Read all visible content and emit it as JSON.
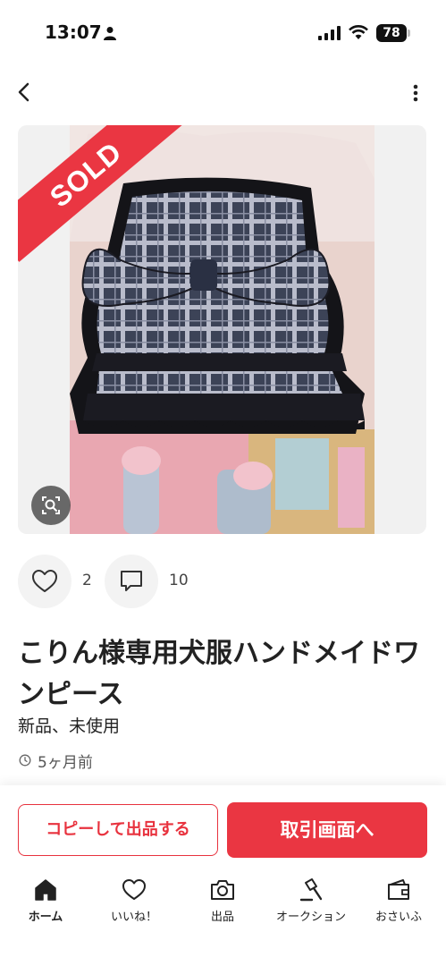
{
  "status": {
    "time": "13:07",
    "battery": "78"
  },
  "product": {
    "sold_badge": "SOLD",
    "likes": "2",
    "comments": "10",
    "title": "こりん様専用犬服ハンドメイドワンピース",
    "condition": "新品、未使用",
    "posted": "5ヶ月前"
  },
  "actions": {
    "copy_label": "コピーして出品する",
    "trade_label": "取引画面へ"
  },
  "tabbar": {
    "items": [
      {
        "label": "ホーム",
        "icon": "home-icon",
        "active": true
      },
      {
        "label": "いいね！",
        "icon": "heart-icon"
      },
      {
        "label": "出品",
        "icon": "camera-icon"
      },
      {
        "label": "オークション",
        "icon": "gavel-icon"
      },
      {
        "label": "おさいふ",
        "icon": "wallet-icon"
      }
    ]
  },
  "colors": {
    "accent": "#ea3642",
    "icon_bg": "#f3f3f3"
  }
}
